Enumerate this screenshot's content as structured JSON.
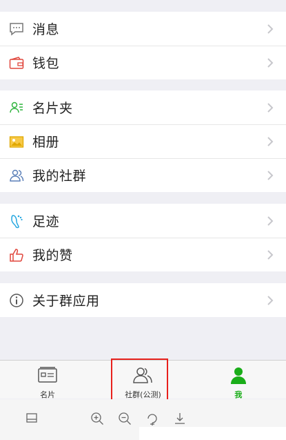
{
  "menu": {
    "group1": [
      {
        "label": "消息",
        "icon": "message-icon"
      },
      {
        "label": "钱包",
        "icon": "wallet-icon"
      }
    ],
    "group2": [
      {
        "label": "名片夹",
        "icon": "card-holder-icon"
      },
      {
        "label": "相册",
        "icon": "photo-album-icon"
      },
      {
        "label": "我的社群",
        "icon": "community-icon"
      }
    ],
    "group3": [
      {
        "label": "足迹",
        "icon": "footprint-icon"
      },
      {
        "label": "我的赞",
        "icon": "thumbs-up-icon"
      }
    ],
    "group4": [
      {
        "label": "关于群应用",
        "icon": "info-icon"
      }
    ]
  },
  "tabbar": {
    "tabs": [
      {
        "label": "名片",
        "icon": "business-card-icon"
      },
      {
        "label": "社群(公测)",
        "icon": "group-people-icon"
      },
      {
        "label": "我",
        "icon": "person-icon"
      }
    ],
    "active_tab": "我"
  },
  "colors": {
    "accent_green": "#1aad19",
    "highlight_red": "#e8201c",
    "background": "#efeff4"
  }
}
